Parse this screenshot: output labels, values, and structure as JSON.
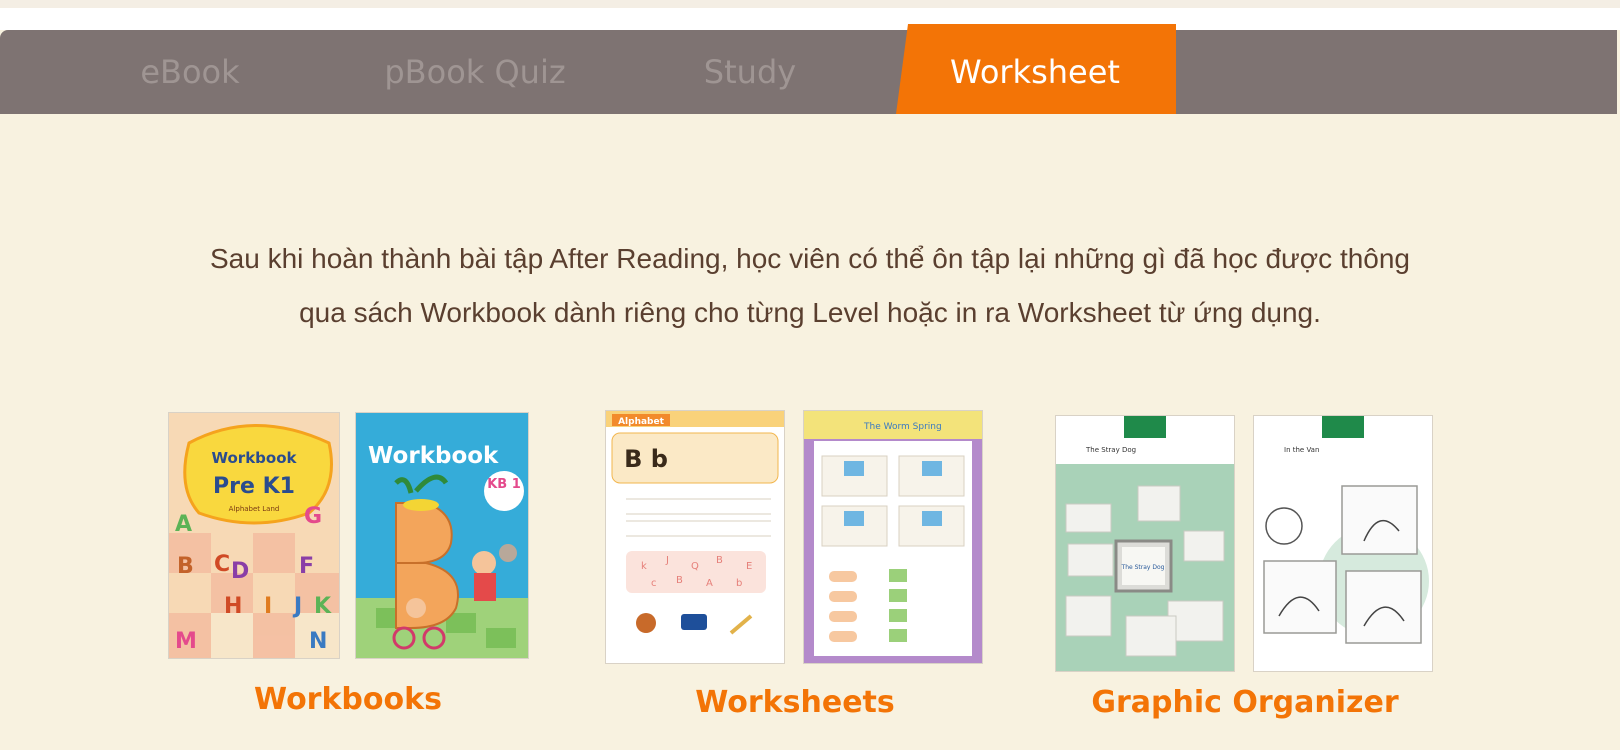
{
  "tabs": [
    {
      "label": "eBook",
      "active": false
    },
    {
      "label": "pBook Quiz",
      "active": false
    },
    {
      "label": "Study",
      "active": false
    },
    {
      "label": "Worksheet",
      "active": true
    }
  ],
  "intro": {
    "line1": "Sau khi hoàn thành bài tập After Reading, học viên có thể ôn tập lại những gì đã học được thông",
    "line2": "qua sách Workbook dành riêng cho từng Level hoặc in ra Worksheet từ ứng dụng."
  },
  "cards": [
    {
      "caption": "Workbooks",
      "book1_title": "Workbook",
      "book1_subtitle": "Pre K1",
      "book1_tag": "Alphabet Land",
      "book2_title": "Workbook",
      "book2_badge": "KB 1"
    },
    {
      "caption": "Worksheets",
      "sheet1_header": "Alphabet",
      "sheet1_letters": "B b",
      "sheet2_header": "The Worm Spring"
    },
    {
      "caption": "Graphic Organizer",
      "org1_title": "The Stray Dog",
      "org2_title": "In the Van"
    }
  ],
  "colors": {
    "accent": "#f37406",
    "tabbar": "#7e7372",
    "background": "#f8f2e0",
    "text": "#5a3f2f"
  }
}
